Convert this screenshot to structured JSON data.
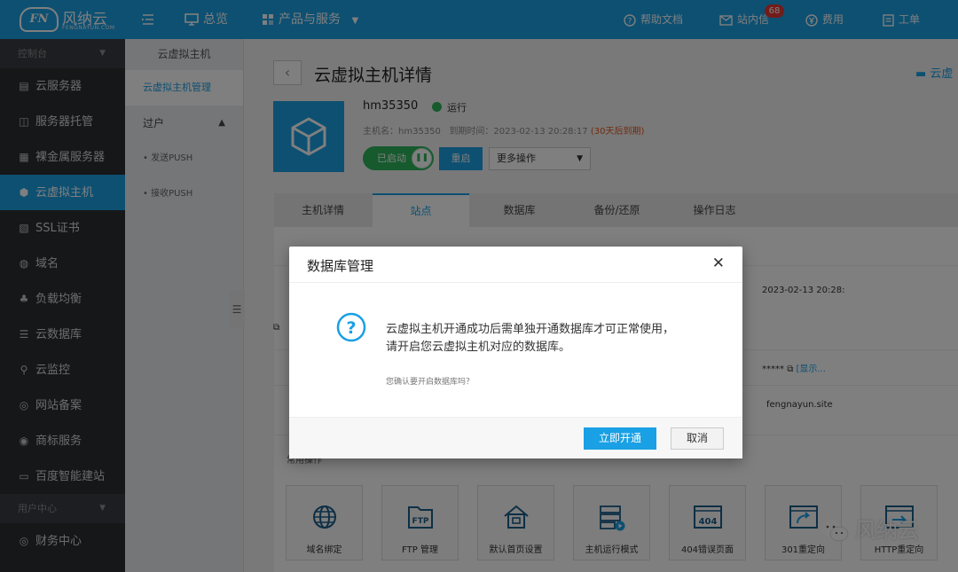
{
  "brand": {
    "name": "风纳云",
    "sub": "FENGNAYUN.COM",
    "mark": "FN"
  },
  "topnav": {
    "overview": "总览",
    "products": "产品与服务",
    "docs": "帮助文档",
    "inbox": "站内信",
    "inbox_count": "68",
    "fees": "费用",
    "tickets": "工单"
  },
  "sidebar": {
    "section_console": "控制台",
    "section_user": "用户中心",
    "items": [
      {
        "label": "云服务器",
        "icon": "server-icon"
      },
      {
        "label": "服务器托管",
        "icon": "hosting-icon"
      },
      {
        "label": "裸金属服务器",
        "icon": "bare-metal-icon"
      },
      {
        "label": "云虚拟主机",
        "icon": "cube-icon"
      },
      {
        "label": "SSL证书",
        "icon": "certificate-icon"
      },
      {
        "label": "域名",
        "icon": "globe-icon"
      },
      {
        "label": "负载均衡",
        "icon": "balance-icon"
      },
      {
        "label": "云数据库",
        "icon": "database-icon"
      },
      {
        "label": "云监控",
        "icon": "monitor-icon"
      },
      {
        "label": "网站备案",
        "icon": "record-icon"
      },
      {
        "label": "商标服务",
        "icon": "trademark-icon"
      },
      {
        "label": "百度智能建站",
        "icon": "site-builder-icon"
      }
    ],
    "finance": "财务中心"
  },
  "subnav": {
    "title": "云虚拟主机",
    "manage": "云虚拟主机管理",
    "transfer": "过户",
    "send_push": "发送PUSH",
    "receive_push": "接收PUSH"
  },
  "page": {
    "title": "云虚拟主机详情",
    "right_label": "云虚",
    "host_name": "hm35350",
    "status": "运行",
    "meta_host": "主机名：hm35350",
    "meta_expire": "到期时间：2023-02-13 20:28:17",
    "meta_warn": "(30天后到期)",
    "toggle_label": "已启动",
    "restart": "重启",
    "more_ops": "更多操作"
  },
  "tabs": [
    "主机详情",
    "站点",
    "数据库",
    "备份/还原",
    "操作日志"
  ],
  "content": {
    "date": "2023-02-13 20:28:",
    "password_mask": "*****",
    "show": "[显示...",
    "domain": "fengnayun.site",
    "section": "常用操作"
  },
  "tools": [
    {
      "label": "域名绑定",
      "icon": "globe-icon"
    },
    {
      "label": "FTP 管理",
      "icon": "ftp-icon"
    },
    {
      "label": "默认首页设置",
      "icon": "home-icon"
    },
    {
      "label": "主机运行模式",
      "icon": "server-mode-icon"
    },
    {
      "label": "404错误页面",
      "icon": "error-404-icon"
    },
    {
      "label": "301重定向",
      "icon": "redirect-301-icon"
    },
    {
      "label": "HTTP重定向",
      "icon": "http-redirect-icon"
    }
  ],
  "watermark": "风纳云",
  "modal": {
    "title": "数据库管理",
    "line1": "云虚拟主机开通成功后需单独开通数据库才可正常使用，",
    "line2": "请开启您云虚拟主机对应的数据库。",
    "confirm": "您确认要开启数据库吗？",
    "ok": "立即开通",
    "cancel": "取消"
  }
}
